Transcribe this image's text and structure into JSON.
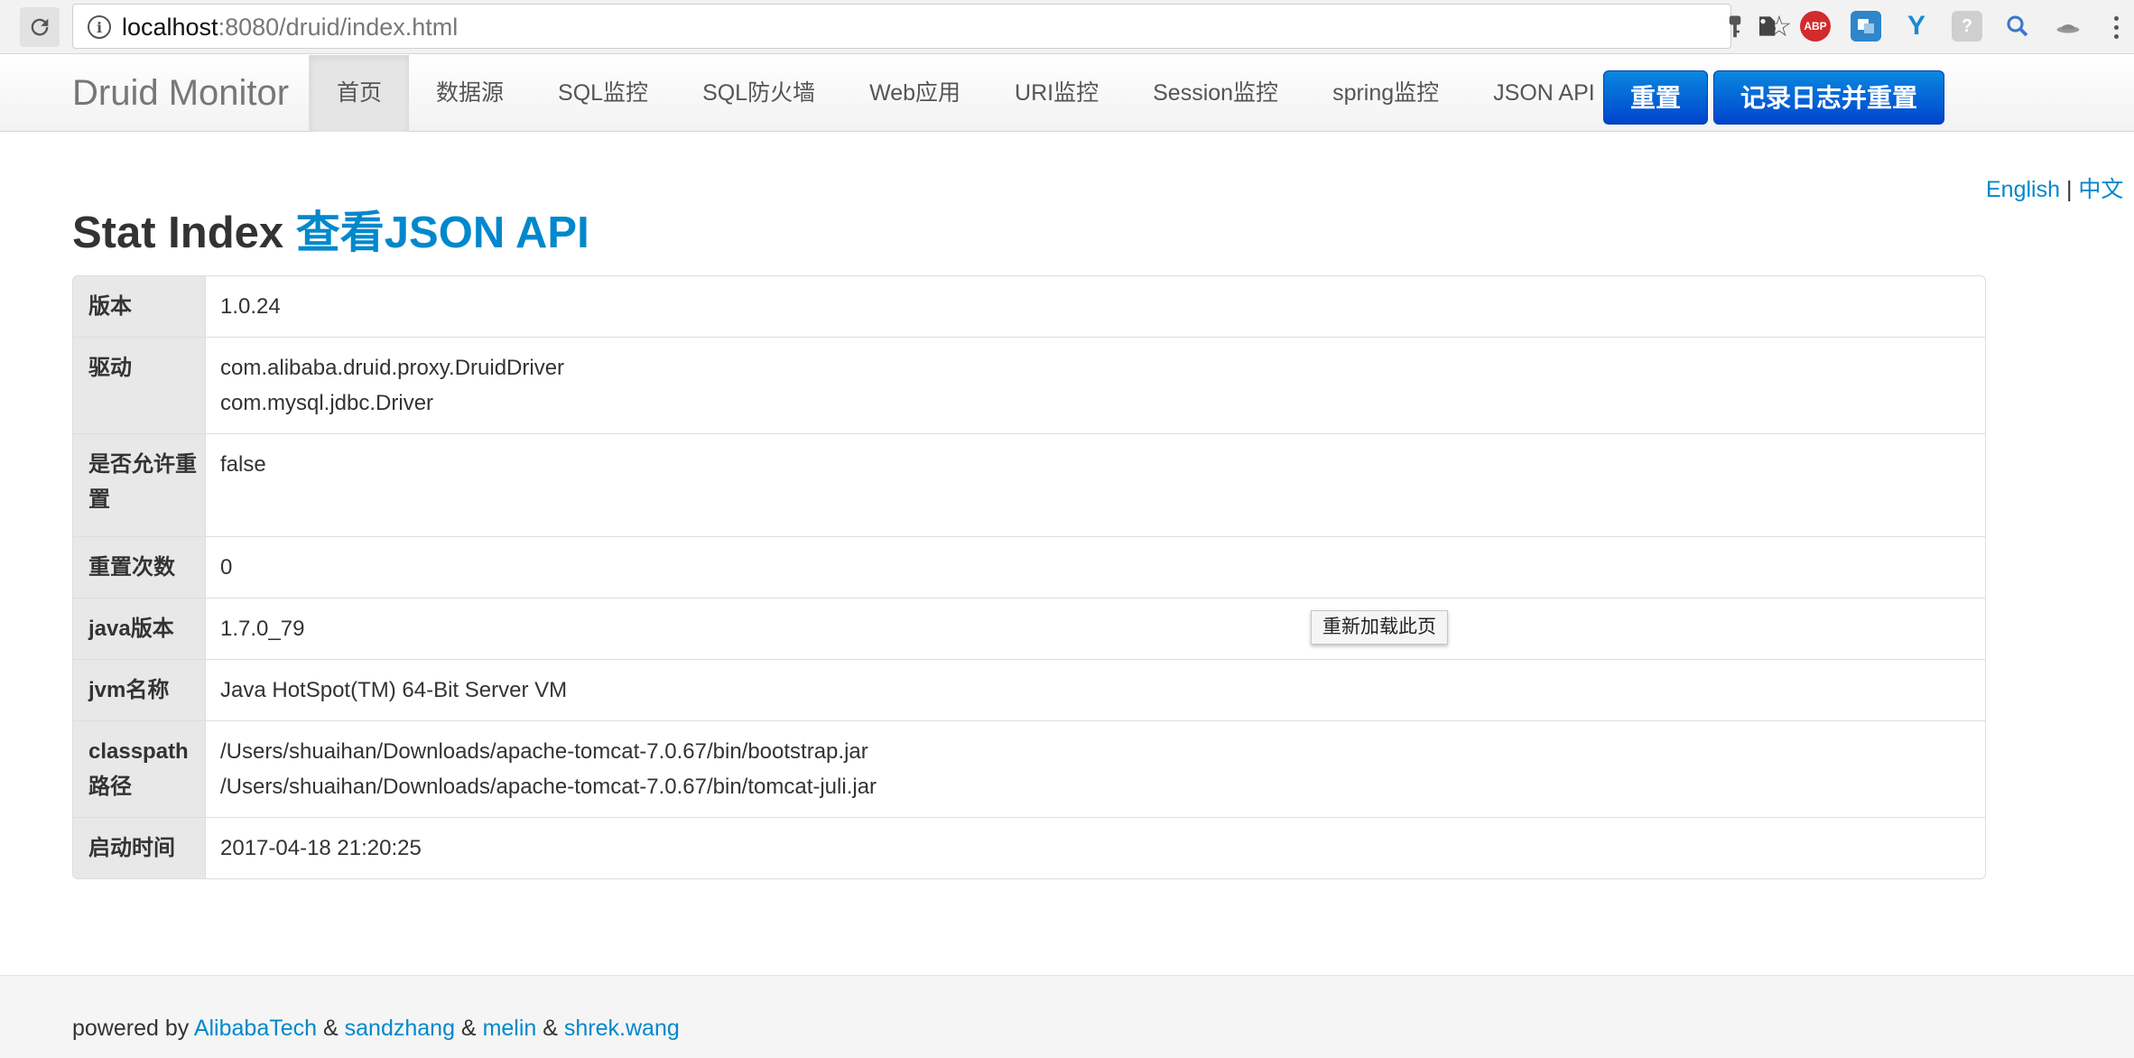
{
  "browser": {
    "url_host": "localhost",
    "url_rest": ":8080/druid/index.html",
    "icons": [
      "reload-icon",
      "info-icon",
      "key-icon",
      "star-icon",
      "evernote-icon",
      "adblock-icon",
      "translate-icon",
      "y-icon",
      "photoshop-icon",
      "search-icon",
      "hat-icon",
      "menu-icon"
    ],
    "ext_abp_label": "ABP",
    "ext_y_label": "Y",
    "ext_ps_label": "?"
  },
  "navbar": {
    "brand": "Druid Monitor",
    "items": [
      {
        "label": "首页",
        "active": true
      },
      {
        "label": "数据源",
        "active": false
      },
      {
        "label": "SQL监控",
        "active": false
      },
      {
        "label": "SQL防火墙",
        "active": false
      },
      {
        "label": "Web应用",
        "active": false
      },
      {
        "label": "URI监控",
        "active": false
      },
      {
        "label": "Session监控",
        "active": false
      },
      {
        "label": "spring监控",
        "active": false
      },
      {
        "label": "JSON API",
        "active": false
      }
    ],
    "reset_button": "重置",
    "log_reset_button": "记录日志并重置",
    "accent_color": "#0066cc"
  },
  "lang": {
    "english": "English",
    "separator": "|",
    "chinese": "中文"
  },
  "page": {
    "title": "Stat Index",
    "title_link": "查看JSON API",
    "link_color": "#0088cc"
  },
  "stats": {
    "version_label": "版本",
    "version_value": "1.0.24",
    "driver_label": "驱动",
    "driver_values": [
      "com.alibaba.druid.proxy.DruidDriver",
      "com.mysql.jdbc.Driver"
    ],
    "reset_enable_label": "是否允许重置",
    "reset_enable_value": "false",
    "reset_count_label": "重置次数",
    "reset_count_value": "0",
    "java_version_label": "java版本",
    "java_version_value": "1.7.0_79",
    "jvm_name_label": "jvm名称",
    "jvm_name_value": "Java HotSpot(TM) 64-Bit Server VM",
    "classpath_label": "classpath路径",
    "classpath_values": [
      "/Users/shuaihan/Downloads/apache-tomcat-7.0.67/bin/bootstrap.jar",
      "/Users/shuaihan/Downloads/apache-tomcat-7.0.67/bin/tomcat-juli.jar"
    ],
    "start_time_label": "启动时间",
    "start_time_value": "2017-04-18 21:20:25"
  },
  "tooltip": "重新加载此页",
  "footer": {
    "prefix": "powered by",
    "amp": "&",
    "links": [
      "AlibabaTech",
      "sandzhang",
      "melin",
      "shrek.wang"
    ]
  }
}
